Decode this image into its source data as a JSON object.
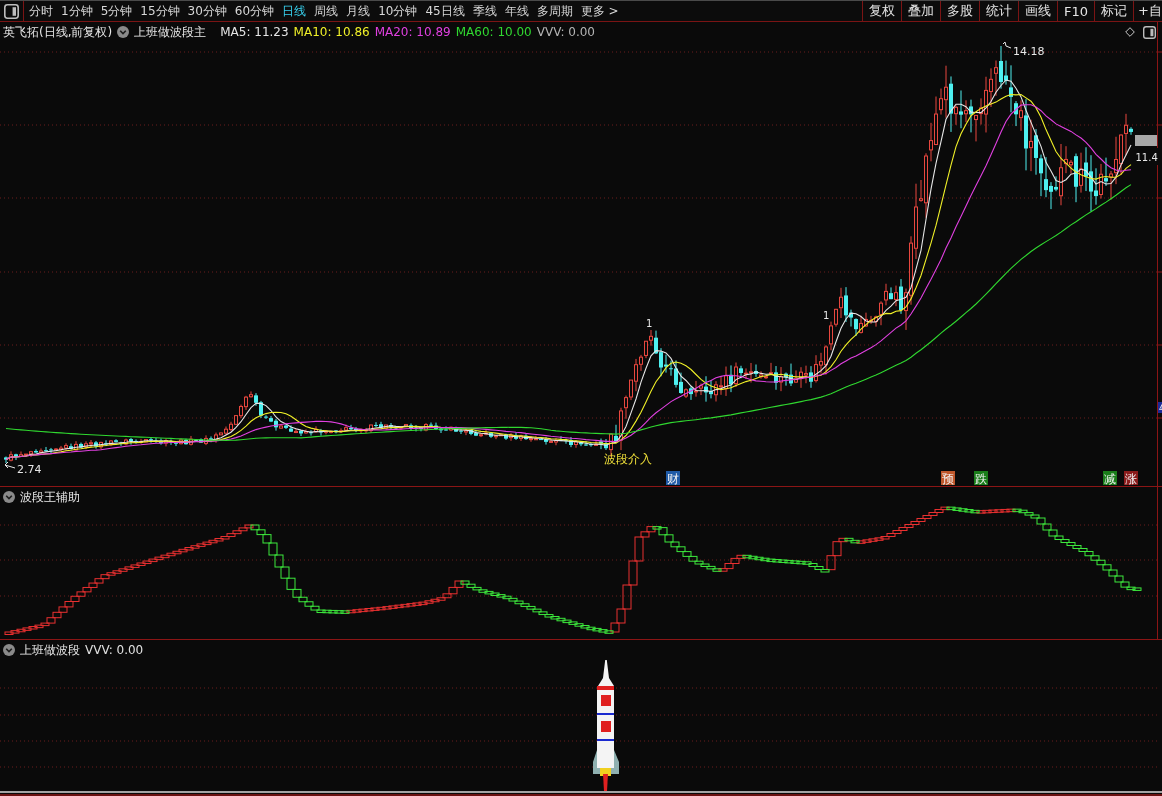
{
  "toolbar": {
    "periods": [
      {
        "label": "分时",
        "selected": false
      },
      {
        "label": "1分钟",
        "selected": false
      },
      {
        "label": "5分钟",
        "selected": false
      },
      {
        "label": "15分钟",
        "selected": false
      },
      {
        "label": "30分钟",
        "selected": false
      },
      {
        "label": "60分钟",
        "selected": false
      },
      {
        "label": "日线",
        "selected": true
      },
      {
        "label": "周线",
        "selected": false
      },
      {
        "label": "月线",
        "selected": false
      },
      {
        "label": "10分钟",
        "selected": false
      },
      {
        "label": "45日线",
        "selected": false
      },
      {
        "label": "季线",
        "selected": false
      },
      {
        "label": "年线",
        "selected": false
      },
      {
        "label": "多周期",
        "selected": false
      }
    ],
    "more": "更多 >",
    "actions": [
      "复权",
      "叠加",
      "多股",
      "统计",
      "画线",
      "F10",
      "标记",
      "+自"
    ]
  },
  "main_panel": {
    "title": "英飞拓(日线,前复权)",
    "indicator": "上班做波段主",
    "readouts": [
      {
        "label": "MA5: 11.23",
        "color": "#e6e6e6"
      },
      {
        "label": "MA10: 10.86",
        "color": "#f0f028"
      },
      {
        "label": "MA20: 10.89",
        "color": "#e040e0"
      },
      {
        "label": "MA60: 10.00",
        "color": "#30d830"
      },
      {
        "label": "VVV: 0.00",
        "color": "#b4b4b4"
      }
    ],
    "high_label": "14.18",
    "low_label": "2.74",
    "last_price": "11.4",
    "entry_label": "波段介入",
    "marks": [
      "1",
      "1"
    ],
    "signals": [
      {
        "label": "财",
        "color": "#1f5aa6"
      },
      {
        "label": "预",
        "color": "#c0582c"
      },
      {
        "label": "跌",
        "color": "#1a7d1a"
      },
      {
        "label": "减",
        "color": "#1a7d1a"
      },
      {
        "label": "涨",
        "color": "#8a1c1c"
      }
    ]
  },
  "aux_panel": {
    "title": "波段王辅助"
  },
  "signal_panel": {
    "title": "上班做波段",
    "readout": "VVV: 0.00"
  }
}
